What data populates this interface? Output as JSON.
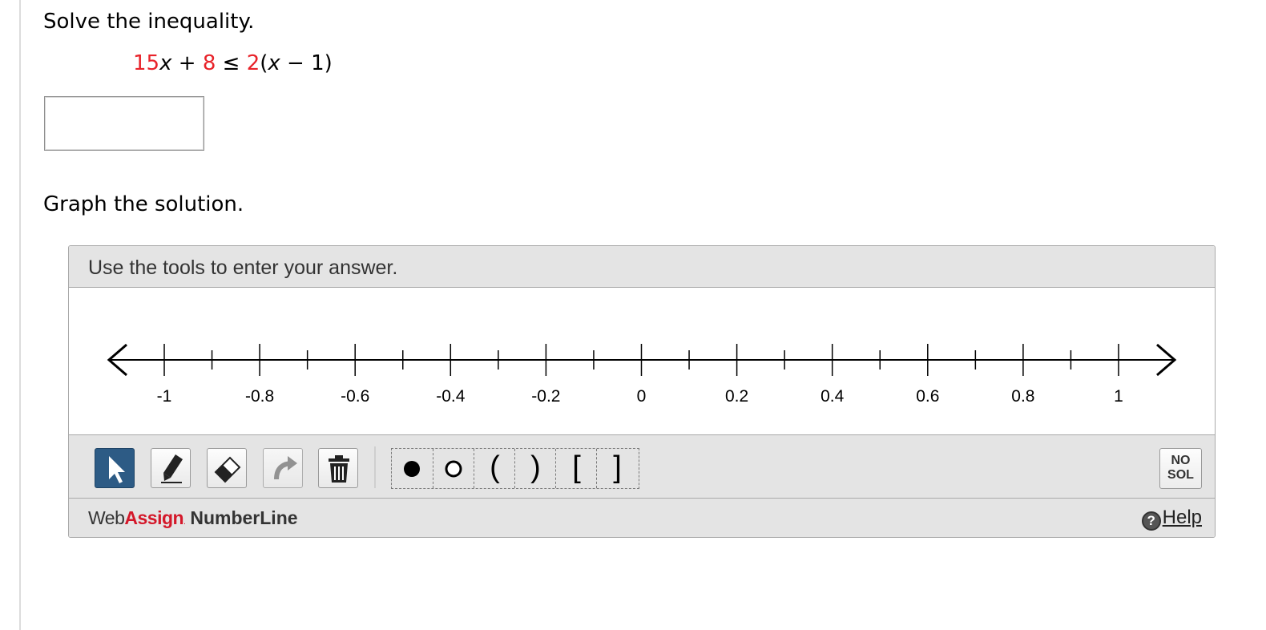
{
  "question": {
    "prompt": "Solve the inequality.",
    "equation": {
      "coef1": "15",
      "var1": "x",
      "plus": " + ",
      "const1": "8",
      "leq": " ≤ ",
      "coef2": "2",
      "open": "(",
      "var2": "x",
      "minus": " − 1)"
    },
    "answer_value": "",
    "graph_prompt": "Graph the solution."
  },
  "widget": {
    "instruction": "Use the tools to enter your answer.",
    "number_line": {
      "min": -1,
      "max": 1,
      "major_step": 0.2,
      "minor_step": 0.1,
      "tick_labels": [
        "-1",
        "-0.8",
        "-0.6",
        "-0.4",
        "-0.2",
        "0",
        "0.2",
        "0.4",
        "0.6",
        "0.8",
        "1"
      ]
    },
    "tools": [
      {
        "name": "select-tool",
        "icon": "arrow-cursor-icon",
        "active": true
      },
      {
        "name": "pencil-tool",
        "icon": "pencil-icon",
        "active": false
      },
      {
        "name": "eraser-tool",
        "icon": "eraser-icon",
        "active": false
      },
      {
        "name": "undo-tool",
        "icon": "undo-icon",
        "active": false
      },
      {
        "name": "trash-tool",
        "icon": "trash-icon",
        "active": false
      }
    ],
    "symbols": {
      "closed_point": "filled-dot-icon",
      "open_point": "open-dot-icon",
      "open_paren": "(",
      "close_paren": ")",
      "open_bracket": "[",
      "close_bracket": "]"
    },
    "no_solution": {
      "line1": "NO",
      "line2": "SOL"
    },
    "brand": {
      "web": "Web",
      "assign": "Assign",
      "dot": ".",
      "product": "NumberLine"
    },
    "help": {
      "icon_glyph": "?",
      "label": "Help"
    },
    "colors": {
      "accent_red": "#d4182a",
      "active_tool": "#2d5b85",
      "equation_red": "#e8232a"
    }
  }
}
